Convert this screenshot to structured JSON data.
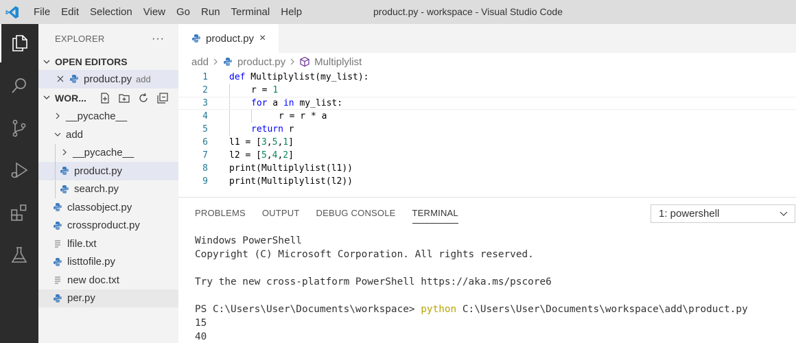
{
  "window": {
    "title": "product.py - workspace - Visual Studio Code"
  },
  "menu": [
    "File",
    "Edit",
    "Selection",
    "View",
    "Go",
    "Run",
    "Terminal",
    "Help"
  ],
  "activity_bar": [
    "files-icon",
    "search-icon",
    "source-control-icon",
    "run-debug-icon",
    "extensions-icon",
    "testing-icon"
  ],
  "sidebar": {
    "title": "EXPLORER",
    "more": "···",
    "open_editors": {
      "label": "OPEN EDITORS",
      "items": [
        {
          "name": "product.py",
          "desc": "add"
        }
      ]
    },
    "workspace": {
      "label": "WOR...",
      "tree": [
        {
          "name": "__pycache__",
          "type": "folder"
        },
        {
          "name": "add",
          "type": "folder-open"
        },
        {
          "name": "__pycache__",
          "type": "folder"
        },
        {
          "name": "product.py",
          "type": "py"
        },
        {
          "name": "search.py",
          "type": "py"
        },
        {
          "name": "classobject.py",
          "type": "py"
        },
        {
          "name": "crossproduct.py",
          "type": "py"
        },
        {
          "name": "lfile.txt",
          "type": "txt"
        },
        {
          "name": "listtofile.py",
          "type": "py"
        },
        {
          "name": "new doc.txt",
          "type": "txt"
        },
        {
          "name": "per.py",
          "type": "py"
        }
      ]
    }
  },
  "editor": {
    "tab": {
      "label": "product.py",
      "close": "×"
    },
    "breadcrumb": [
      "add",
      "product.py",
      "Multiplylist"
    ],
    "lines": [
      {
        "n": "1",
        "text": "def Multiplylist(my_list):"
      },
      {
        "n": "2",
        "text": "r = 1"
      },
      {
        "n": "3",
        "text": "for a in my_list:"
      },
      {
        "n": "4",
        "text": "r = r * a"
      },
      {
        "n": "5",
        "text": "return r"
      },
      {
        "n": "6",
        "text": "l1 = [3,5,1]"
      },
      {
        "n": "7",
        "text": "l2 = [5,4,2]"
      },
      {
        "n": "8",
        "text": "print(Multiplylist(l1))"
      },
      {
        "n": "9",
        "text": "print(Multiplylist(l2))"
      }
    ]
  },
  "panel": {
    "tabs": [
      "PROBLEMS",
      "OUTPUT",
      "DEBUG CONSOLE",
      "TERMINAL"
    ],
    "active_tab": "TERMINAL",
    "terminal_select": "1: powershell",
    "terminal": {
      "l1": "Windows PowerShell",
      "l2": "Copyright (C) Microsoft Corporation. All rights reserved.",
      "l3": "Try the new cross-platform PowerShell https://aka.ms/pscore6",
      "prompt": "PS C:\\Users\\User\\Documents\\workspace> ",
      "cmd": "python",
      "args": " C:\\Users\\User\\Documents\\workspace\\add\\product.py",
      "out1": "15",
      "out2": "40"
    }
  },
  "colors": {
    "accent": "#007acc",
    "activity_bg": "#2c2c2c",
    "python_icon": "#3b7bbf",
    "keyword": "#0000ff",
    "number": "#098658"
  }
}
